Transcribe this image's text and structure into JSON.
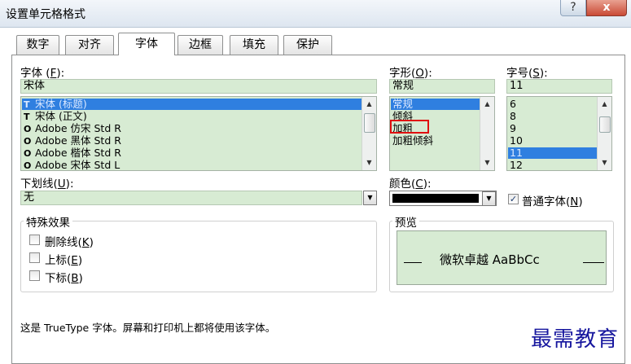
{
  "window": {
    "title": "设置单元格格式",
    "help_label": "?",
    "close_label": "x"
  },
  "tabs": [
    {
      "label": "数字"
    },
    {
      "label": "对齐"
    },
    {
      "label": "字体"
    },
    {
      "label": "边框"
    },
    {
      "label": "填充"
    },
    {
      "label": "保护"
    }
  ],
  "active_tab": "字体",
  "font": {
    "label": "字体",
    "accel": "F",
    "value": "宋体",
    "items": [
      {
        "text": "宋体 (标题)",
        "selected": true
      },
      {
        "text": "宋体 (正文)",
        "selected": false
      },
      {
        "text": "Adobe 仿宋 Std R",
        "selected": false
      },
      {
        "text": "Adobe 黑体 Std R",
        "selected": false
      },
      {
        "text": "Adobe 楷体 Std R",
        "selected": false
      },
      {
        "text": "Adobe 宋体 Std L",
        "selected": false
      }
    ]
  },
  "style": {
    "label": "字形",
    "accel": "O",
    "value": "常规",
    "items": [
      {
        "text": "常规",
        "selected": true
      },
      {
        "text": "倾斜",
        "selected": false
      },
      {
        "text": "加粗",
        "selected": false
      },
      {
        "text": "加粗倾斜",
        "selected": false
      }
    ]
  },
  "size": {
    "label": "字号",
    "accel": "S",
    "value": "11",
    "items": [
      {
        "text": "6",
        "selected": false
      },
      {
        "text": "8",
        "selected": false
      },
      {
        "text": "9",
        "selected": false
      },
      {
        "text": "10",
        "selected": false
      },
      {
        "text": "11",
        "selected": true
      },
      {
        "text": "12",
        "selected": false
      }
    ]
  },
  "underline": {
    "label": "下划线",
    "accel": "U",
    "value": "无"
  },
  "color": {
    "label": "颜色",
    "accel": "C",
    "swatch": "#000000"
  },
  "normal_font": {
    "label": "普通字体",
    "accel": "N",
    "checked": true
  },
  "effects": {
    "title": "特殊效果",
    "items": [
      {
        "label": "删除线",
        "accel": "K",
        "checked": false
      },
      {
        "label": "上标",
        "accel": "E",
        "checked": false
      },
      {
        "label": "下标",
        "accel": "B",
        "checked": false
      }
    ]
  },
  "preview": {
    "title": "预览",
    "text": "微软卓越  AaBbCc"
  },
  "info": "这是 TrueType 字体。屏幕和打印机上都将使用该字体。",
  "watermark": "最需教育",
  "colors": {
    "field_bg": "#d7ebd3",
    "selection": "#2f7fe0",
    "highlight": "#e01010",
    "watermark": "#16169e"
  }
}
